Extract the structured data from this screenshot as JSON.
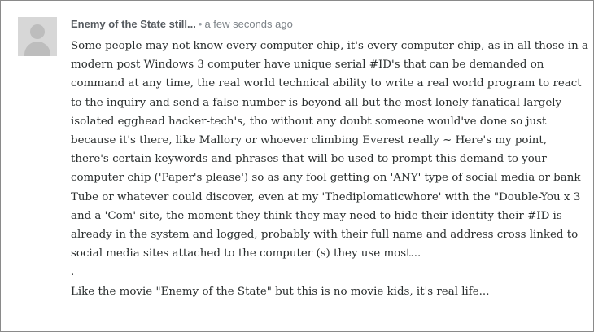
{
  "comment": {
    "author": "Enemy of the State still...",
    "separator": "•",
    "timestamp": "a few seconds ago",
    "paragraphs": [
      "Some people may not know every computer chip, it's every computer chip, as in all those in a modern post Windows 3 computer have unique serial #ID's that can be demanded on command at any time, the real world technical ability to write a real world program to react to the inquiry and send a false number is beyond all but the most lonely fanatical largely isolated egghead hacker-tech's, tho without any doubt someone would've done so just because it's there, like Mallory or whoever climbing Everest really ~ Here's my point, there's certain keywords and phrases that will be used to prompt this demand to your computer chip ('Paper's please') so as any fool getting on 'ANY' type of social media or bank Tube or whatever could discover, even at my 'Thediplomaticwhore' with the \"Double-You x 3 and a 'Com' site, the moment they think they may need to hide their identity their #ID is already in the system and logged, probably with their full name and address cross linked to social media sites attached to the computer (s) they use most...",
      ".",
      "Like the movie \"Enemy of the State\" but this is no movie kids, it's real life..."
    ]
  },
  "icons": {
    "avatar": "default-user-avatar-icon"
  }
}
